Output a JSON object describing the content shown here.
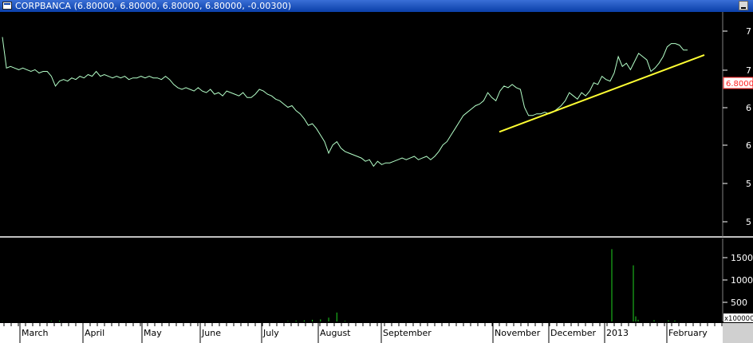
{
  "window": {
    "title": "CORPBANCA (6.80000, 6.80000, 6.80000, 6.80000, -0.00300)"
  },
  "colors": {
    "background": "#000000",
    "price_line": "#b4ffc8",
    "trend_line": "#ffff33",
    "volume_bars": "#1fd21f",
    "last_price_tag": "#ff2020",
    "separator": "#c0c0c0",
    "title_bar": "#0a3fa8"
  },
  "chart_data": [
    {
      "type": "line",
      "series": [
        {
          "values": [
            6.84,
            6.65,
            6.66,
            6.65,
            6.64,
            6.65,
            6.64,
            6.63,
            6.64,
            6.62,
            6.63,
            6.63,
            6.6,
            6.54,
            6.57,
            6.58,
            6.57,
            6.59,
            6.58,
            6.6,
            6.59,
            6.61,
            6.6,
            6.63,
            6.6,
            6.61,
            6.6,
            6.59,
            6.6,
            6.59,
            6.6,
            6.58,
            6.59,
            6.59,
            6.6,
            6.59,
            6.6,
            6.59,
            6.59,
            6.58,
            6.6,
            6.58,
            6.55,
            6.53,
            6.52,
            6.53,
            6.52,
            6.51,
            6.53,
            6.51,
            6.5,
            6.52,
            6.49,
            6.5,
            6.48,
            6.51,
            6.5,
            6.49,
            6.48,
            6.5,
            6.47,
            6.47,
            6.49,
            6.52,
            6.51,
            6.49,
            6.48,
            6.46,
            6.45,
            6.43,
            6.41,
            6.42,
            6.39,
            6.37,
            6.34,
            6.3,
            6.31,
            6.28,
            6.24,
            6.2,
            6.13,
            6.18,
            6.2,
            6.16,
            6.14,
            6.13,
            6.12,
            6.11,
            6.1,
            6.08,
            6.09,
            6.05,
            6.08,
            6.06,
            6.07,
            6.07,
            6.08,
            6.09,
            6.1,
            6.09,
            6.1,
            6.11,
            6.09,
            6.1,
            6.11,
            6.09,
            6.11,
            6.14,
            6.18,
            6.2,
            6.24,
            6.28,
            6.32,
            6.36,
            6.38,
            6.4,
            6.42,
            6.43,
            6.45,
            6.5,
            6.47,
            6.45,
            6.51,
            6.54,
            6.53,
            6.55,
            6.53,
            6.52,
            6.41,
            6.36,
            6.36,
            6.37,
            6.37,
            6.38,
            6.37,
            6.38,
            6.4,
            6.42,
            6.45,
            6.5,
            6.48,
            6.46,
            6.5,
            6.48,
            6.51,
            6.56,
            6.55,
            6.6,
            6.58,
            6.57,
            6.62,
            6.72,
            6.66,
            6.68,
            6.64,
            6.69,
            6.74,
            6.72,
            6.7,
            6.63,
            6.65,
            6.68,
            6.72,
            6.78,
            6.8,
            6.8,
            6.79,
            6.76,
            6.76
          ]
        }
      ],
      "trendline": {
        "start_value": 6.26,
        "end_value": 6.73
      },
      "y_ticks": [
        "7",
        "7",
        "6",
        "6",
        "5",
        "5"
      ],
      "last_price_label": "6.8000",
      "x_months": [
        "March",
        "April",
        "May",
        "June",
        "July",
        "August",
        "September",
        "November",
        "December",
        "2013",
        "February"
      ]
    },
    {
      "type": "bar",
      "series": [
        {
          "values": [
            5,
            0,
            0,
            0,
            0,
            0,
            0,
            0,
            0,
            0,
            0,
            0,
            12,
            0,
            18,
            0,
            0,
            0,
            0,
            0,
            0,
            0,
            0,
            0,
            0,
            0,
            0,
            0,
            0,
            0,
            0,
            0,
            0,
            0,
            0,
            0,
            0,
            0,
            0,
            0,
            0,
            0,
            0,
            0,
            0,
            0,
            0,
            0,
            0,
            0,
            0,
            0,
            0,
            0,
            0,
            0,
            0,
            0,
            0,
            0,
            0,
            0,
            0,
            0,
            0,
            0,
            0,
            0,
            0,
            0,
            10,
            0,
            20,
            0,
            25,
            0,
            40,
            0,
            50,
            0,
            90,
            0,
            210,
            0,
            15,
            0,
            0,
            0,
            0,
            0,
            0,
            0,
            0,
            0,
            0,
            0,
            0,
            0,
            0,
            0,
            0,
            0,
            0,
            0,
            0,
            0,
            0,
            0,
            0,
            0,
            0,
            0,
            0,
            0,
            0,
            0,
            0,
            0,
            0,
            0,
            0,
            0,
            0,
            0,
            0,
            0,
            0,
            0,
            0,
            0,
            0,
            0,
            0,
            0,
            0,
            0,
            0,
            0,
            0,
            0,
            0,
            0,
            0,
            0,
            0,
            0,
            0,
            0,
            0,
            0,
            0,
            0,
            0,
            0,
            0,
            0,
            0,
            0,
            0,
            0,
            0,
            0,
            0,
            0,
            0,
            0,
            0,
            0,
            0,
            0,
            0,
            0
          ]
        }
      ],
      "spikes": [
        1700,
        1320,
        120,
        40,
        30,
        25,
        20
      ],
      "y_ticks": [
        "1500",
        "1000",
        "500"
      ],
      "y_unit_label": "x100000"
    }
  ]
}
